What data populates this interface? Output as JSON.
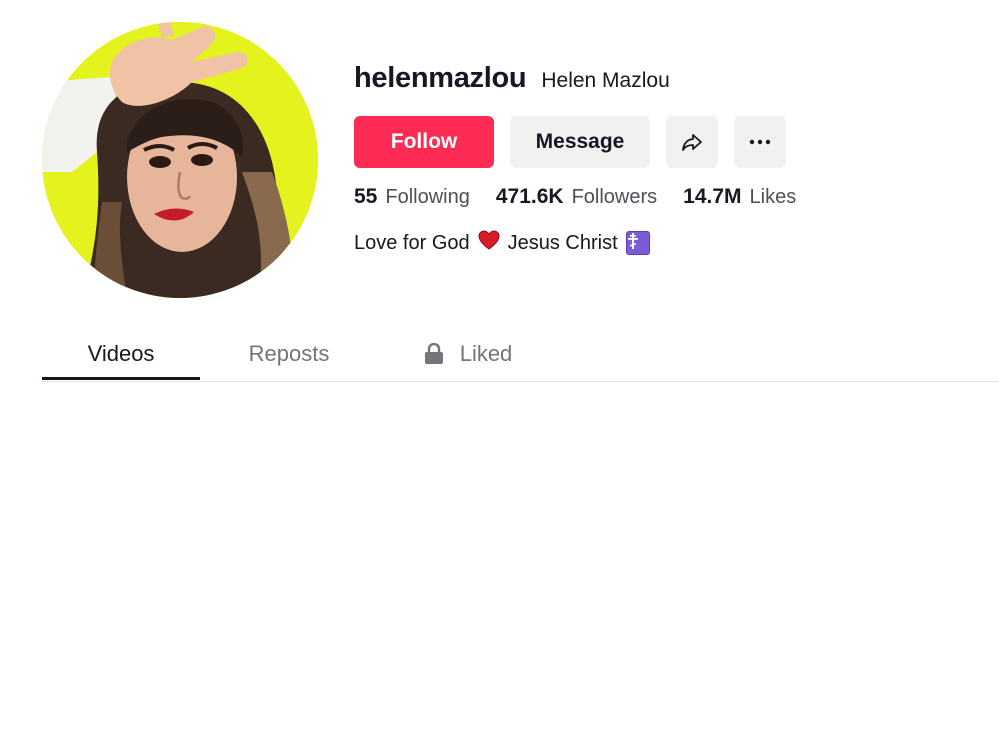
{
  "profile": {
    "username": "helenmazlou",
    "nickname": "Helen Mazlou",
    "bio_text_1": "Love for God",
    "bio_text_2": "Jesus Christ",
    "bio_heart_icon": "red-heart-emoji",
    "bio_cross_icon": "orthodox-cross-emoji"
  },
  "actions": {
    "follow_label": "Follow",
    "message_label": "Message",
    "share_icon": "share-arrow-icon",
    "more_icon": "more-dots-icon"
  },
  "stats": {
    "following": {
      "value": "55",
      "label": "Following"
    },
    "followers": {
      "value": "471.6K",
      "label": "Followers"
    },
    "likes": {
      "value": "14.7M",
      "label": "Likes"
    }
  },
  "tabs": {
    "videos": "Videos",
    "reposts": "Reposts",
    "liked": "Liked",
    "active": "Videos"
  },
  "colors": {
    "accent": "#fe2c55",
    "avatar_bg": "#e4f21d",
    "text_primary": "#161823",
    "text_secondary": "#74757b"
  }
}
